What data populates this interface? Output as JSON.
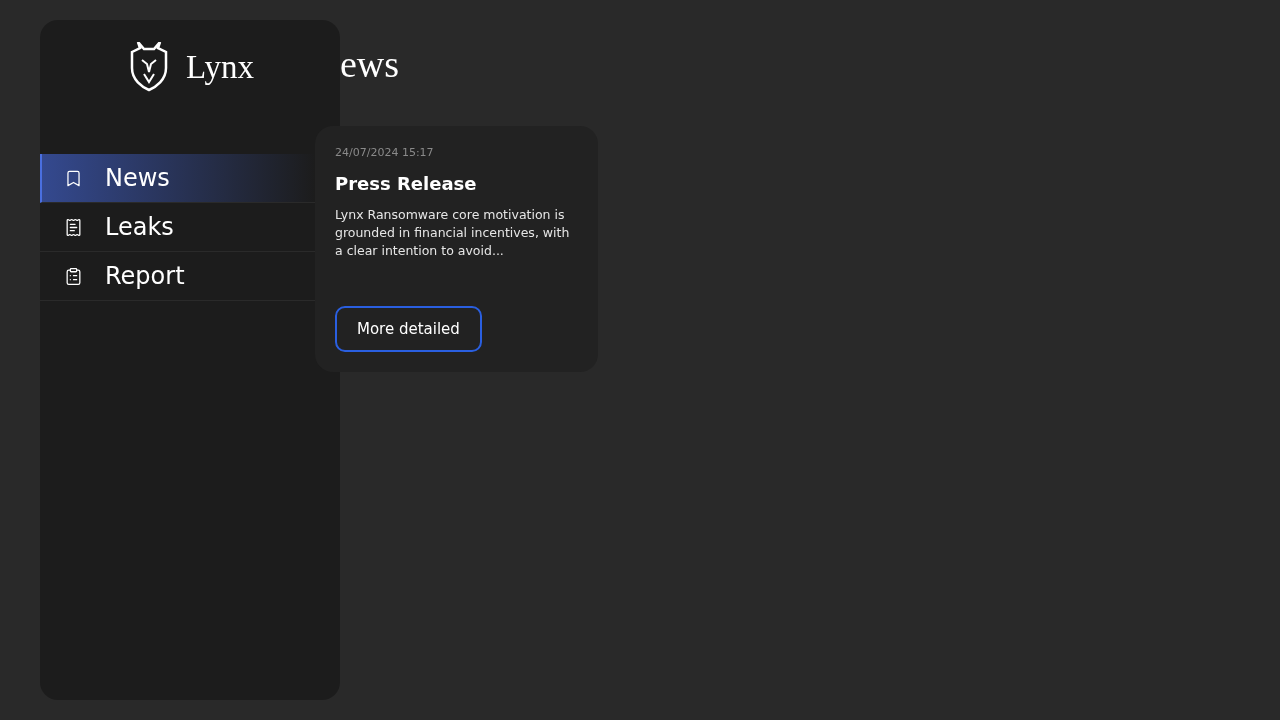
{
  "brand": {
    "name": "Lynx"
  },
  "page": {
    "title": "ews"
  },
  "sidebar": {
    "items": [
      {
        "label": "News",
        "selected": true
      },
      {
        "label": "Leaks",
        "selected": false
      },
      {
        "label": "Report",
        "selected": false
      }
    ]
  },
  "news": [
    {
      "date": "24/07/2024 15:17",
      "title": "Press Release",
      "excerpt": "Lynx Ransomware core motivation is grounded in financial incentives, with a clear intention to avoid...",
      "button": "More detailed"
    }
  ]
}
